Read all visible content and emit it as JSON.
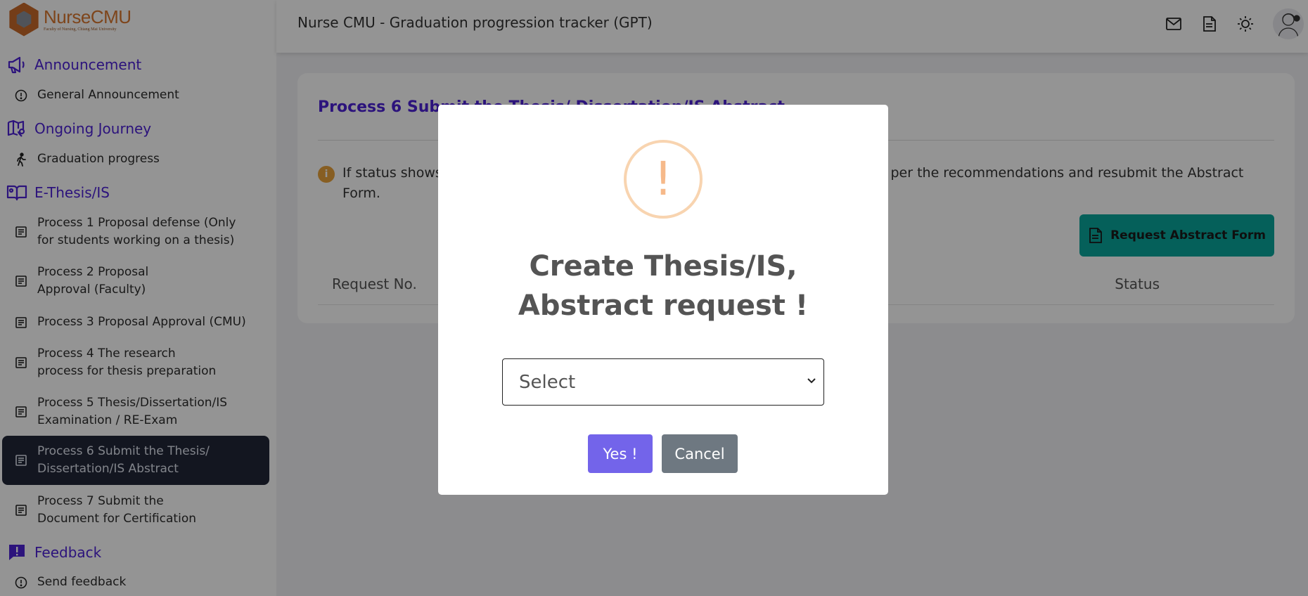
{
  "app": {
    "logo_name": "NurseCMU",
    "logo_sub": "Faculty of Nursing, Chiang Mai University"
  },
  "header": {
    "title": "Nurse CMU - Graduation progression tracker (GPT)",
    "icons": [
      "mail-icon",
      "document-icon",
      "theme-sun-icon"
    ]
  },
  "sidebar": {
    "sections": [
      {
        "label": "Announcement",
        "icon": "megaphone-icon",
        "items": [
          {
            "label": "General Announcement",
            "icon": "info-circle-icon"
          }
        ]
      },
      {
        "label": "Ongoing Journey",
        "icon": "map-icon",
        "items": [
          {
            "label": "Graduation progress",
            "icon": "walking-icon"
          }
        ]
      },
      {
        "label": "E-Thesis/IS",
        "icon": "book-icon",
        "items": [
          {
            "label": "Process 1 Proposal defense (Only\nfor students working on a thesis)"
          },
          {
            "label": "Process 2 Proposal\nApproval (Faculty)"
          },
          {
            "label": "Process 3 Proposal Approval (CMU)"
          },
          {
            "label": "Process 4 The research\nprocess for thesis preparation"
          },
          {
            "label": "Process 5 Thesis/Dissertation/IS\nExamination / RE-Exam"
          },
          {
            "label": "Process 6 Submit the Thesis/\nDissertation/IS Abstract",
            "active": true
          },
          {
            "label": "Process 7 Submit the\nDocument for Certification"
          }
        ]
      },
      {
        "label": "Feedback",
        "icon": "feedback-icon",
        "items": [
          {
            "label": "Send feedback",
            "icon": "info-circle-icon"
          }
        ]
      }
    ]
  },
  "card": {
    "title": "Process 6 Submit the Thesis/ Dissertation/IS Abstract",
    "info_text": "If status shows \"Send back\", please correct the Thesis/Dissertation/IS Abstract as per the recommendations and resubmit the Abstract Form.",
    "request_button": "Request Abstract Form",
    "table_headers": [
      "Request No.",
      "Status"
    ]
  },
  "modal": {
    "title": "Create Thesis/IS, Abstract request !",
    "select_value": "Select",
    "yes_label": "Yes !",
    "cancel_label": "Cancel"
  },
  "colors": {
    "accent": "#4c21d6",
    "teal_button": "#0aa69b",
    "confirm_button": "#7364ea",
    "cancel_button": "#6e7881",
    "warning": "#f6b98a"
  }
}
